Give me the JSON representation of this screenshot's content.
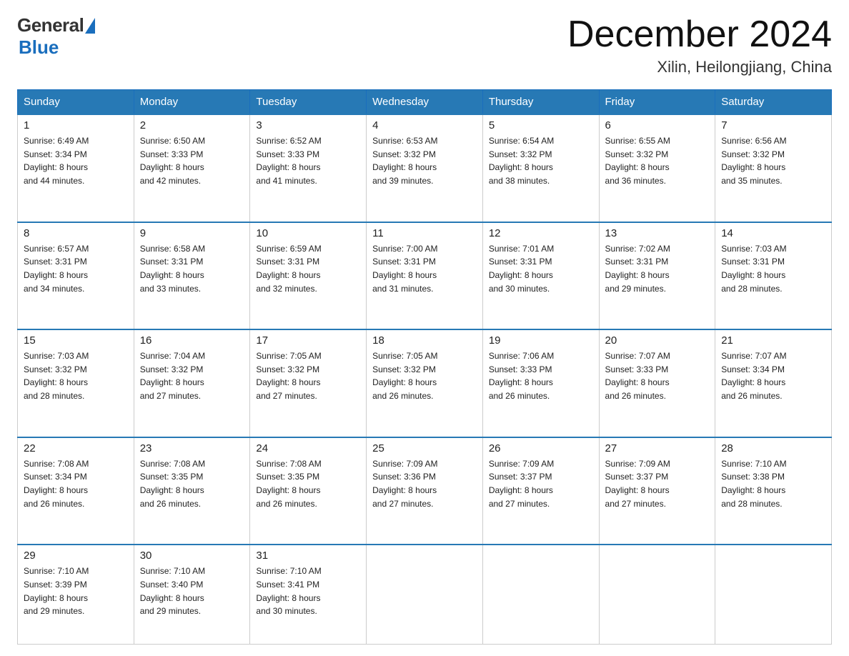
{
  "logo": {
    "general": "General",
    "blue": "Blue"
  },
  "title": "December 2024",
  "subtitle": "Xilin, Heilongjiang, China",
  "headers": [
    "Sunday",
    "Monday",
    "Tuesday",
    "Wednesday",
    "Thursday",
    "Friday",
    "Saturday"
  ],
  "weeks": [
    [
      {
        "day": "1",
        "info": "Sunrise: 6:49 AM\nSunset: 3:34 PM\nDaylight: 8 hours\nand 44 minutes."
      },
      {
        "day": "2",
        "info": "Sunrise: 6:50 AM\nSunset: 3:33 PM\nDaylight: 8 hours\nand 42 minutes."
      },
      {
        "day": "3",
        "info": "Sunrise: 6:52 AM\nSunset: 3:33 PM\nDaylight: 8 hours\nand 41 minutes."
      },
      {
        "day": "4",
        "info": "Sunrise: 6:53 AM\nSunset: 3:32 PM\nDaylight: 8 hours\nand 39 minutes."
      },
      {
        "day": "5",
        "info": "Sunrise: 6:54 AM\nSunset: 3:32 PM\nDaylight: 8 hours\nand 38 minutes."
      },
      {
        "day": "6",
        "info": "Sunrise: 6:55 AM\nSunset: 3:32 PM\nDaylight: 8 hours\nand 36 minutes."
      },
      {
        "day": "7",
        "info": "Sunrise: 6:56 AM\nSunset: 3:32 PM\nDaylight: 8 hours\nand 35 minutes."
      }
    ],
    [
      {
        "day": "8",
        "info": "Sunrise: 6:57 AM\nSunset: 3:31 PM\nDaylight: 8 hours\nand 34 minutes."
      },
      {
        "day": "9",
        "info": "Sunrise: 6:58 AM\nSunset: 3:31 PM\nDaylight: 8 hours\nand 33 minutes."
      },
      {
        "day": "10",
        "info": "Sunrise: 6:59 AM\nSunset: 3:31 PM\nDaylight: 8 hours\nand 32 minutes."
      },
      {
        "day": "11",
        "info": "Sunrise: 7:00 AM\nSunset: 3:31 PM\nDaylight: 8 hours\nand 31 minutes."
      },
      {
        "day": "12",
        "info": "Sunrise: 7:01 AM\nSunset: 3:31 PM\nDaylight: 8 hours\nand 30 minutes."
      },
      {
        "day": "13",
        "info": "Sunrise: 7:02 AM\nSunset: 3:31 PM\nDaylight: 8 hours\nand 29 minutes."
      },
      {
        "day": "14",
        "info": "Sunrise: 7:03 AM\nSunset: 3:31 PM\nDaylight: 8 hours\nand 28 minutes."
      }
    ],
    [
      {
        "day": "15",
        "info": "Sunrise: 7:03 AM\nSunset: 3:32 PM\nDaylight: 8 hours\nand 28 minutes."
      },
      {
        "day": "16",
        "info": "Sunrise: 7:04 AM\nSunset: 3:32 PM\nDaylight: 8 hours\nand 27 minutes."
      },
      {
        "day": "17",
        "info": "Sunrise: 7:05 AM\nSunset: 3:32 PM\nDaylight: 8 hours\nand 27 minutes."
      },
      {
        "day": "18",
        "info": "Sunrise: 7:05 AM\nSunset: 3:32 PM\nDaylight: 8 hours\nand 26 minutes."
      },
      {
        "day": "19",
        "info": "Sunrise: 7:06 AM\nSunset: 3:33 PM\nDaylight: 8 hours\nand 26 minutes."
      },
      {
        "day": "20",
        "info": "Sunrise: 7:07 AM\nSunset: 3:33 PM\nDaylight: 8 hours\nand 26 minutes."
      },
      {
        "day": "21",
        "info": "Sunrise: 7:07 AM\nSunset: 3:34 PM\nDaylight: 8 hours\nand 26 minutes."
      }
    ],
    [
      {
        "day": "22",
        "info": "Sunrise: 7:08 AM\nSunset: 3:34 PM\nDaylight: 8 hours\nand 26 minutes."
      },
      {
        "day": "23",
        "info": "Sunrise: 7:08 AM\nSunset: 3:35 PM\nDaylight: 8 hours\nand 26 minutes."
      },
      {
        "day": "24",
        "info": "Sunrise: 7:08 AM\nSunset: 3:35 PM\nDaylight: 8 hours\nand 26 minutes."
      },
      {
        "day": "25",
        "info": "Sunrise: 7:09 AM\nSunset: 3:36 PM\nDaylight: 8 hours\nand 27 minutes."
      },
      {
        "day": "26",
        "info": "Sunrise: 7:09 AM\nSunset: 3:37 PM\nDaylight: 8 hours\nand 27 minutes."
      },
      {
        "day": "27",
        "info": "Sunrise: 7:09 AM\nSunset: 3:37 PM\nDaylight: 8 hours\nand 27 minutes."
      },
      {
        "day": "28",
        "info": "Sunrise: 7:10 AM\nSunset: 3:38 PM\nDaylight: 8 hours\nand 28 minutes."
      }
    ],
    [
      {
        "day": "29",
        "info": "Sunrise: 7:10 AM\nSunset: 3:39 PM\nDaylight: 8 hours\nand 29 minutes."
      },
      {
        "day": "30",
        "info": "Sunrise: 7:10 AM\nSunset: 3:40 PM\nDaylight: 8 hours\nand 29 minutes."
      },
      {
        "day": "31",
        "info": "Sunrise: 7:10 AM\nSunset: 3:41 PM\nDaylight: 8 hours\nand 30 minutes."
      },
      null,
      null,
      null,
      null
    ]
  ]
}
